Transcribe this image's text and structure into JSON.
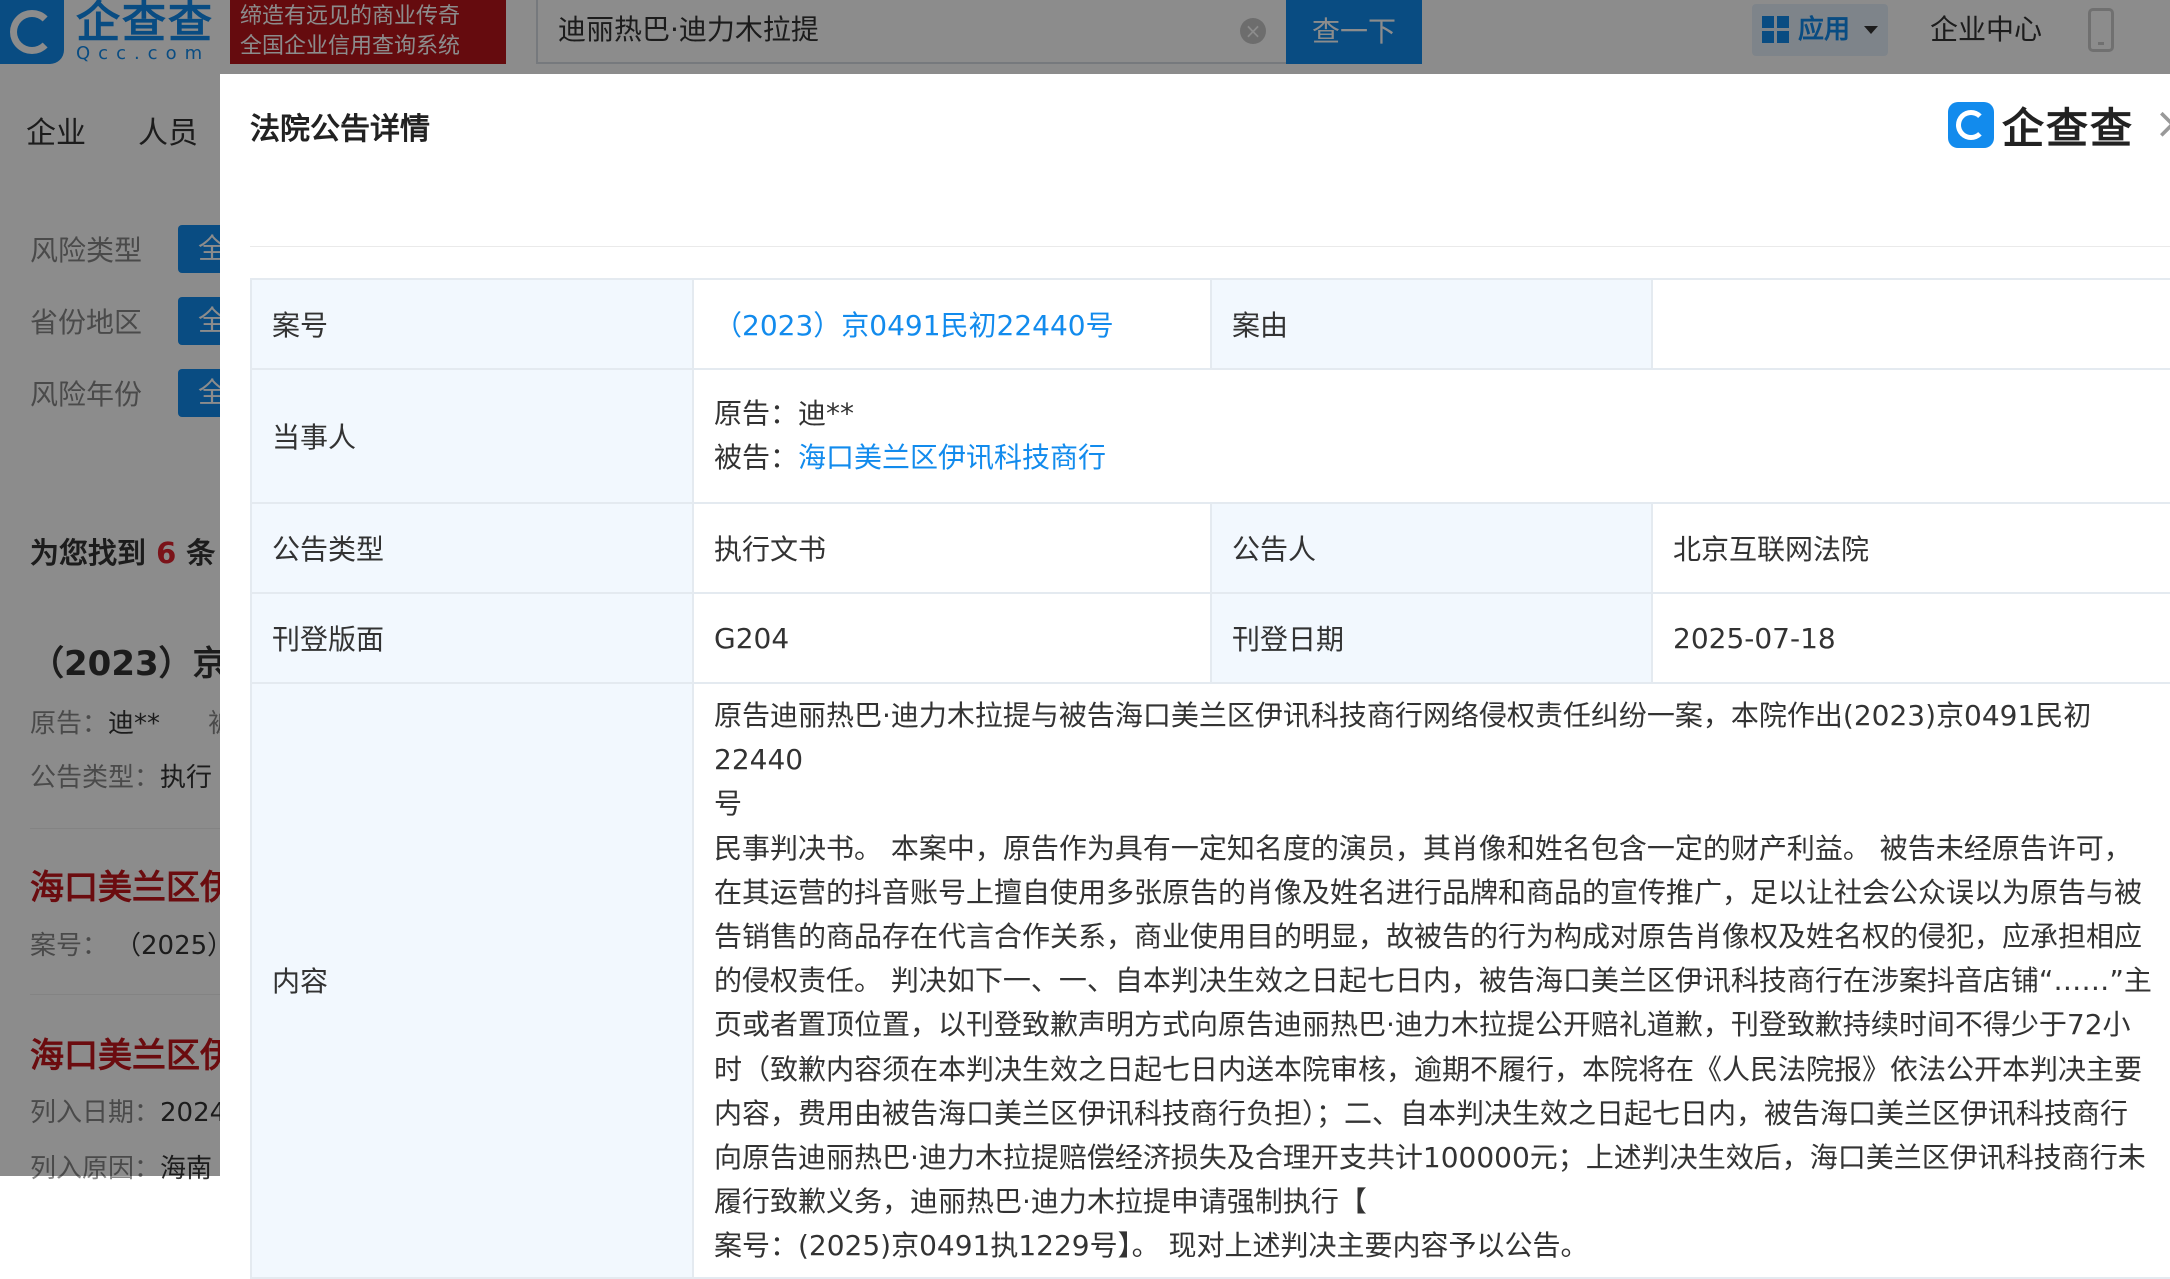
{
  "header": {
    "logo_cn": "企查查",
    "logo_en": "Qcc.com",
    "slogan_line1": "缔造有远见的商业传奇",
    "slogan_line2": "全国企业信用查询系统",
    "search_value": "迪丽热巴·迪力木拉提",
    "search_button": "查一下",
    "app_button": "应用",
    "enterprise_center": "企业中心"
  },
  "nav": {
    "items": [
      "企业",
      "人员"
    ]
  },
  "filters": [
    {
      "label": "风险类型",
      "chip": "全"
    },
    {
      "label": "省份地区",
      "chip": "全"
    },
    {
      "label": "风险年份",
      "chip": "全"
    }
  ],
  "results": {
    "prefix": "为您找到",
    "count": "6",
    "suffix": "条",
    "item1": {
      "title": "（2023）京",
      "meta1_label": "原告：",
      "meta1_value": "迪**",
      "meta1_extra": "被",
      "meta2_label": "公告类型：",
      "meta2_value": "执行"
    },
    "item2": {
      "title": "海口美兰区伊",
      "meta_label": "案号：",
      "meta_value": "（2025）"
    },
    "item3": {
      "title": "海口美兰区伊",
      "meta1_label": "列入日期：",
      "meta1_value": "2024",
      "meta2_label": "列入原因：",
      "meta2_value": "海南"
    }
  },
  "modal": {
    "title": "法院公告详情",
    "logo_text": "企查查",
    "close": "×",
    "rows": {
      "case_no_label": "案号",
      "case_no_value": "（2023）京0491民初22440号",
      "cause_label": "案由",
      "cause_value": "",
      "parties_label": "当事人",
      "plaintiff_label": "原告：",
      "plaintiff_value": "迪**",
      "defendant_label": "被告：",
      "defendant_value": "海口美兰区伊讯科技商行",
      "type_label": "公告类型",
      "type_value": "执行文书",
      "announcer_label": "公告人",
      "announcer_value": "北京互联网法院",
      "layout_label": "刊登版面",
      "layout_value": "G204",
      "date_label": "刊登日期",
      "date_value": "2025-07-18",
      "content_label": "内容",
      "content_lines": [
        "原告迪丽热巴·迪力木拉提与被告海口美兰区伊讯科技商行网络侵权责任纠纷一案，本院作出(2023)京0491民初22440",
        "号",
        "民事判决书。 本案中，原告作为具有一定知名度的演员，其肖像和姓名包含一定的财产利益。 被告未经原告许可，",
        "在其运营的抖音账号上擅自使用多张原告的肖像及姓名进行品牌和商品的宣传推广，足以让社会公众误以为原告与被",
        "告销售的商品存在代言合作关系，商业使用目的明显，故被告的行为构成对原告肖像权及姓名权的侵犯，应承担相应",
        "的侵权责任。 判决如下一、一、自本判决生效之日起七日内，被告海口美兰区伊讯科技商行在涉案抖音店铺“……”主",
        "页或者置顶位置，以刊登致歉声明方式向原告迪丽热巴·迪力木拉提公开赔礼道歉，刊登致歉持续时间不得少于72小",
        "时（致歉内容须在本判决生效之日起七日内送本院审核，逾期不履行，本院将在《人民法院报》依法公开本判决主要",
        "内容，费用由被告海口美兰区伊讯科技商行负担）；二、自本判决生效之日起七日内，被告海口美兰区伊讯科技商行",
        "向原告迪丽热巴·迪力木拉提赔偿经济损失及合理开支共计100000元；上述判决生效后，海口美兰区伊讯科技商行未",
        "履行致歉义务，迪丽热巴·迪力木拉提申请强制执行【",
        "案号：(2025)京0491执1229号】。 现对上述判决主要内容予以公告。"
      ]
    }
  }
}
